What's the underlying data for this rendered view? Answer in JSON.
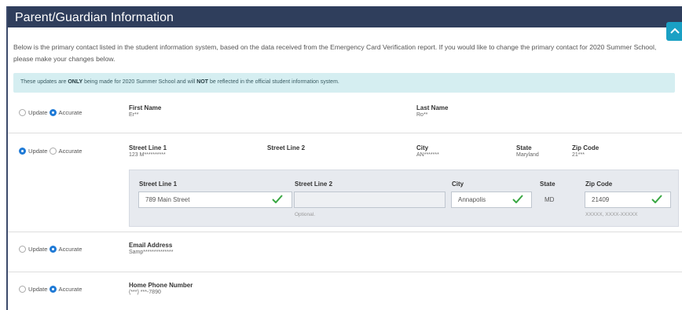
{
  "header": {
    "title": "Parent/Guardian Information"
  },
  "intro": "Below is the primary contact listed in the student information system, based on the data received from the Emergency Card Verification report. If you would like to change the primary contact for 2020 Summer School, please make your changes below.",
  "notice": {
    "part1": "These updates are ",
    "bold1": "ONLY",
    "part2": " being made for 2020 Summer School and will ",
    "bold2": "NOT",
    "part3": " be reflected in the official student information system."
  },
  "radio": {
    "update": "Update",
    "accurate": "Accurate"
  },
  "name_row": {
    "selected": "Accurate",
    "first_label": "First Name",
    "first_value": "Er**",
    "last_label": "Last Name",
    "last_value": "Ro**"
  },
  "address_row": {
    "selected": "Update",
    "street1_label": "Street Line 1",
    "street1_value": "123 M**********",
    "street2_label": "Street Line 2",
    "city_label": "City",
    "city_value": "AN*******",
    "state_label": "State",
    "state_value": "Maryland",
    "zip_label": "Zip Code",
    "zip_value": "21***"
  },
  "address_edit": {
    "street1_label": "Street Line 1",
    "street1_value": "789 Main Street",
    "street2_label": "Street Line 2",
    "street2_value": "",
    "street2_hint": "Optional.",
    "city_label": "City",
    "city_value": "Annapolis",
    "state_label": "State",
    "state_value": "MD",
    "zip_label": "Zip Code",
    "zip_value": "21409",
    "zip_hint": "XXXXX, XXXX-XXXXX"
  },
  "email_row": {
    "selected": "Accurate",
    "label": "Email Address",
    "value": "Samp**************"
  },
  "phone_row": {
    "selected": "Accurate",
    "label": "Home Phone Number",
    "value": "(***) ***-7890"
  },
  "colors": {
    "header_bg": "#2f3e5c",
    "notice_bg": "#d5eef1",
    "accent_blue": "#1f7ad6",
    "check_green": "#3aa843",
    "scroll_btn": "#1aa0c4"
  }
}
